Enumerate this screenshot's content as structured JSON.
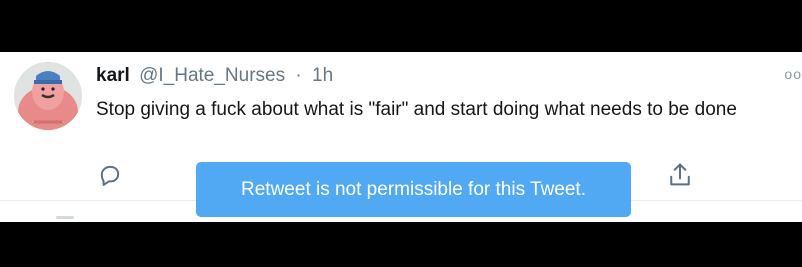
{
  "tweet": {
    "author_name": "karl",
    "author_handle": "@I_Hate_Nurses",
    "separator": "·",
    "time": "1h",
    "text": "Stop giving a fuck about what is \"fair\" and start doing what needs to be done",
    "more_glyph": "oo"
  },
  "actions": {
    "reply_icon": "reply-icon",
    "share_icon": "share-icon"
  },
  "toast": {
    "message": "Retweet is not permissible for this Tweet."
  },
  "colors": {
    "background": "#000000",
    "card": "#ffffff",
    "text": "#14171a",
    "muted": "#657786",
    "toast": "#50a9f2",
    "icon": "#1d9bf0"
  }
}
